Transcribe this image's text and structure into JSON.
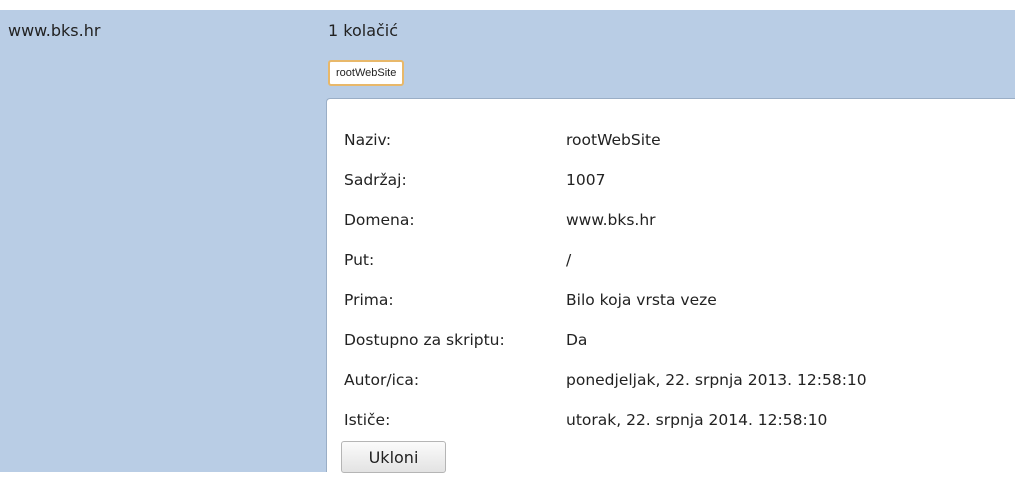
{
  "site": {
    "domain": "www.bks.hr",
    "cookie_count": "1 kolačić"
  },
  "cookie_tag": "rootWebSite",
  "details": {
    "rows": [
      {
        "label": "Naziv:",
        "value": "rootWebSite"
      },
      {
        "label": "Sadržaj:",
        "value": "1007"
      },
      {
        "label": "Domena:",
        "value": "www.bks.hr"
      },
      {
        "label": "Put:",
        "value": "/"
      },
      {
        "label": "Prima:",
        "value": "Bilo koja vrsta veze"
      },
      {
        "label": "Dostupno za skriptu:",
        "value": "Da"
      },
      {
        "label": "Autor/ica:",
        "value": "ponedjeljak, 22. srpnja 2013. 12:58:10"
      },
      {
        "label": "Ističe:",
        "value": "utorak, 22. srpnja 2014. 12:58:10"
      }
    ],
    "remove_label": "Ukloni"
  },
  "colors": {
    "row_background": "#b9cde5",
    "tag_border": "#e8b86a",
    "panel_background": "#ffffff"
  }
}
